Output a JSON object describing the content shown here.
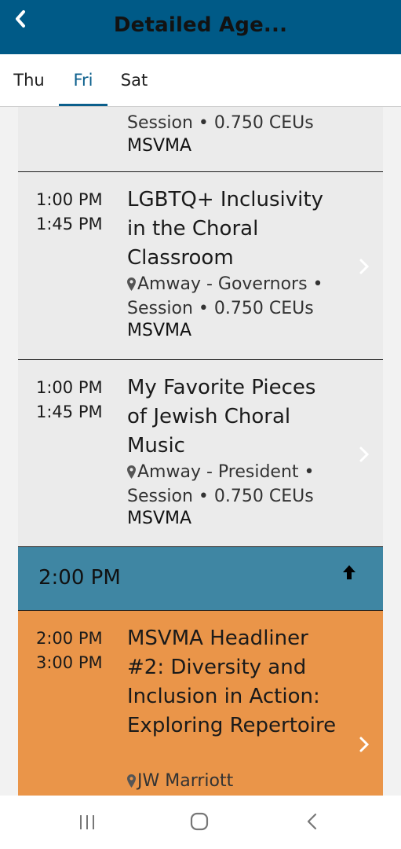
{
  "header": {
    "title": "Detailed Age...",
    "back_icon": "chevron-left-icon"
  },
  "tabs": [
    {
      "label": "Thu",
      "active": false
    },
    {
      "label": "Fri",
      "active": true
    },
    {
      "label": "Sat",
      "active": false
    }
  ],
  "sessions": [
    {
      "meta_line2": "Session • 0.750 CEUs",
      "org": "MSVMA"
    },
    {
      "start": "1:00 PM",
      "end": "1:45 PM",
      "title": "LGBTQ+ Inclusivity in the Choral Classroom",
      "location": "Amway - Governors •",
      "meta_line2": "Session • 0.750 CEUs",
      "org": "MSVMA"
    },
    {
      "start": "1:00 PM",
      "end": "1:45 PM",
      "title": "My Favorite Pieces of Jewish Choral Music",
      "location": "Amway - President •",
      "meta_line2": "Session • 0.750 CEUs",
      "org": "MSVMA"
    },
    {
      "start": "2:00 PM",
      "end": "3:00 PM",
      "title": "MSVMA Headliner #2: Diversity and Inclusion in Action: Exploring Repertoire",
      "location": "JW Marriott"
    }
  ],
  "hour_header": {
    "label": "2:00 PM",
    "icon": "arrow-up-icon"
  },
  "colors": {
    "header_bg": "#005a87",
    "tab_active": "#0b5f8c",
    "card_bg": "#ebebeb",
    "hour_bar_bg": "#3f86a3",
    "highlight_card_bg": "#ea9549"
  },
  "navbar": {
    "recent_icon": "recent-apps-icon",
    "home_icon": "home-icon",
    "back_icon": "back-icon"
  }
}
